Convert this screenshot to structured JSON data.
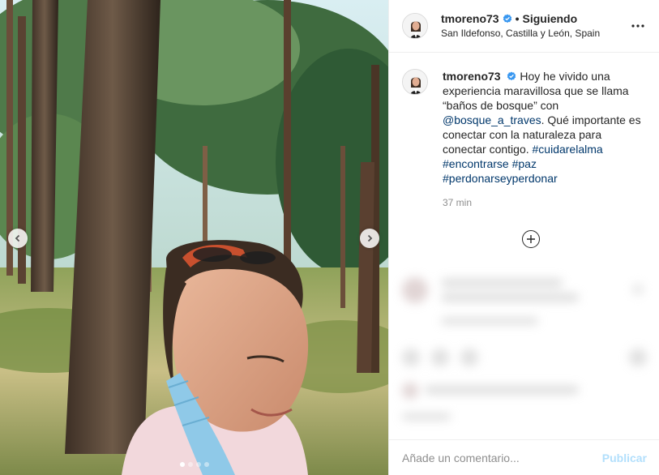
{
  "post": {
    "username": "tmoreno73",
    "follow_state": "Siguiendo",
    "separator": "•",
    "location": "San Ildefonso, Castilla y León, Spain",
    "more_icon": "more-horizontal-icon",
    "verified_color": "#3897f0"
  },
  "caption": {
    "username": "tmoreno73",
    "text_1": "Hoy he vivido una experiencia maravillosa que se llama “baños de bosque” con",
    "mention": "@bosque_a_traves",
    "text_2": ". Qué importante es conectar con la naturaleza para conectar contigo.",
    "hashtags": [
      "#cuidarelalma",
      "#encontrarse",
      "#paz",
      "#perdonarseyperdonar"
    ],
    "time": "37 min"
  },
  "comment_box": {
    "placeholder": "Añade un comentario...",
    "publish_label": "Publicar"
  },
  "carousel": {
    "slide_count": 4,
    "active_index": 0,
    "prev_icon": "chevron-left-icon",
    "next_icon": "chevron-right-icon"
  },
  "colors": {
    "link": "#00376b",
    "publish_disabled": "#b2dffc",
    "muted": "#8e8e8e"
  }
}
